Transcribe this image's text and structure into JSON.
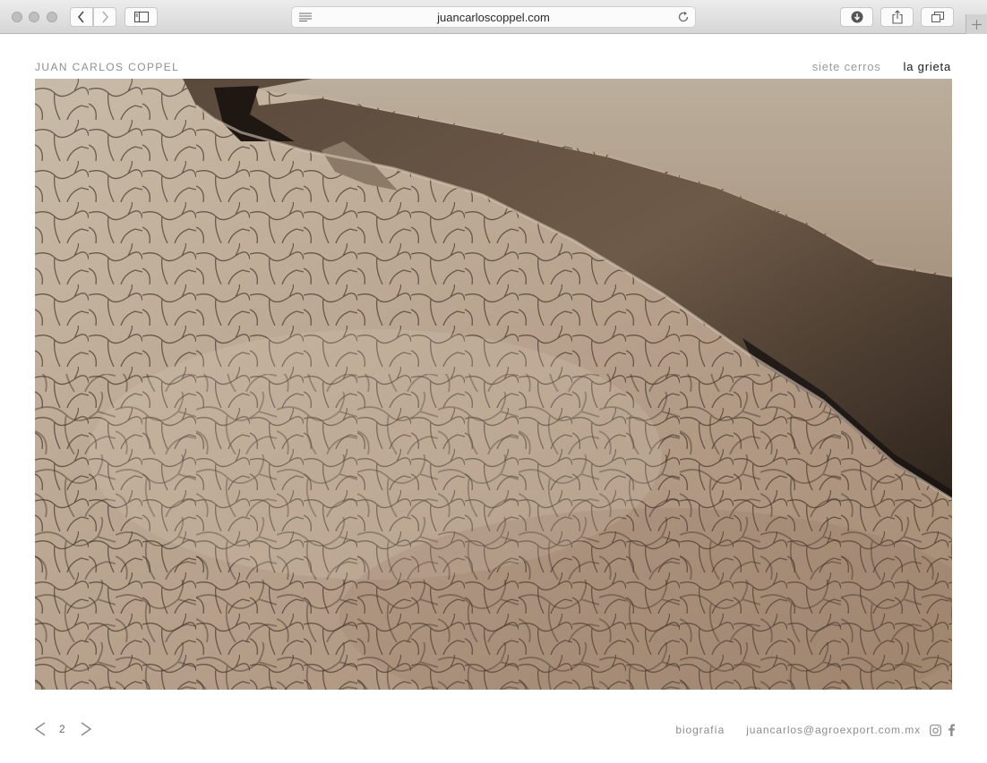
{
  "browser": {
    "url": "juancarloscoppel.com",
    "icons": {
      "back": "chevron-left-icon",
      "forward": "chevron-right-icon",
      "sidebar": "sidebar-icon",
      "reader": "reader-lines-icon",
      "reload": "reload-icon",
      "download": "download-icon",
      "share": "share-icon",
      "tabs": "tabs-icon",
      "new_tab": "plus-icon"
    }
  },
  "header": {
    "site_title": "JUAN CARLOS COPPEL",
    "nav": [
      {
        "label": "siete cerros",
        "active": false
      },
      {
        "label": "la grieta",
        "active": true
      }
    ]
  },
  "gallery": {
    "image_subject": "cracked dry earth with deep fissure"
  },
  "pager": {
    "prev_icon": "chevron-left-icon",
    "current": "2",
    "next_icon": "chevron-right-icon"
  },
  "footer": {
    "bio_link": "biografía",
    "email": "juancarlos@agroexport.com.mx",
    "social_icons": [
      "instagram-icon",
      "facebook-icon"
    ]
  },
  "colors": {
    "title_gray": "#8f8f8f",
    "nav_active": "#1a1a1a",
    "nav_inactive": "#9a9a9a"
  }
}
